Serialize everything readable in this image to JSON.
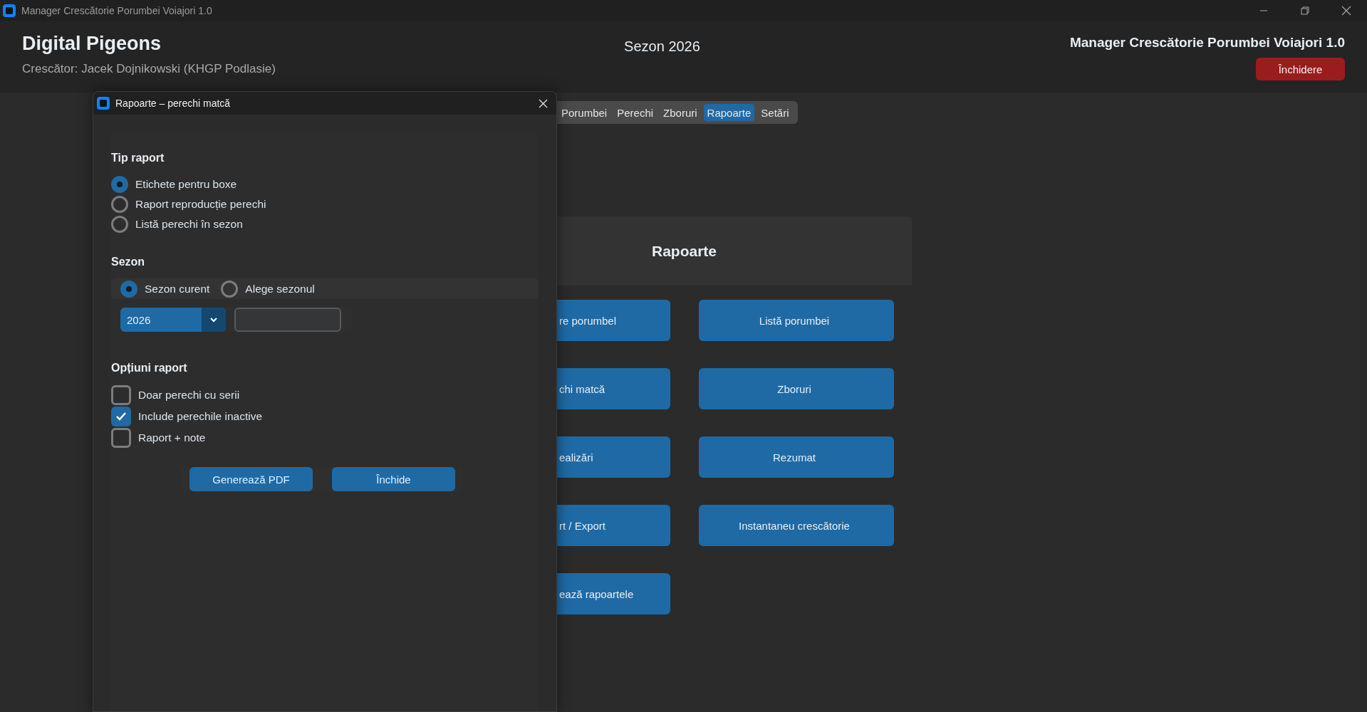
{
  "window": {
    "title": "Manager Crescătorie Porumbei Voiajori 1.0"
  },
  "header": {
    "app_name": "Digital Pigeons",
    "breeder": "Crescător: Jacek Dojnikowski (KHGP Podlasie)",
    "season": "Sezon 2026",
    "title": "Manager Crescătorie Porumbei Voiajori 1.0",
    "close_button": "Închidere"
  },
  "tabs": [
    {
      "label": "Porumbei",
      "selected": false
    },
    {
      "label": "Perechi",
      "selected": false
    },
    {
      "label": "Zboruri",
      "selected": false
    },
    {
      "label": "Rapoarte",
      "selected": true
    },
    {
      "label": "Setări",
      "selected": false
    }
  ],
  "reports_panel": {
    "title": "Rapoarte",
    "buttons": [
      {
        "label": "re porumbel",
        "kind": "clipped"
      },
      {
        "label": "Listă porumbei",
        "kind": "full"
      },
      {
        "label": "chi matcă",
        "kind": "clipped"
      },
      {
        "label": "Zboruri",
        "kind": "full"
      },
      {
        "label": "ealizări",
        "kind": "clipped"
      },
      {
        "label": "Rezumat",
        "kind": "full"
      },
      {
        "label": "rt / Export",
        "kind": "clipped"
      },
      {
        "label": "Instantaneu crescătorie",
        "kind": "full"
      },
      {
        "label": "ează rapoartele",
        "kind": "clipped"
      }
    ]
  },
  "dialog": {
    "title": "Rapoarte – perechi matcă",
    "report_type": {
      "heading": "Tip raport",
      "options": [
        {
          "label": "Etichete pentru boxe",
          "selected": true
        },
        {
          "label": "Raport reproducție perechi",
          "selected": false
        },
        {
          "label": "Listă perechi în sezon",
          "selected": false
        }
      ]
    },
    "season": {
      "heading": "Sezon",
      "options": [
        {
          "label": "Sezon curent",
          "selected": true
        },
        {
          "label": "Alege sezonul",
          "selected": false
        }
      ],
      "dropdown_value": "2026"
    },
    "report_options": {
      "heading": "Opțiuni raport",
      "checkboxes": [
        {
          "label": "Doar perechi cu serii",
          "checked": false
        },
        {
          "label": "Include perechile inactive",
          "checked": true
        },
        {
          "label": "Raport + note",
          "checked": false
        }
      ]
    },
    "buttons": [
      "Generează PDF",
      "Închide"
    ]
  }
}
